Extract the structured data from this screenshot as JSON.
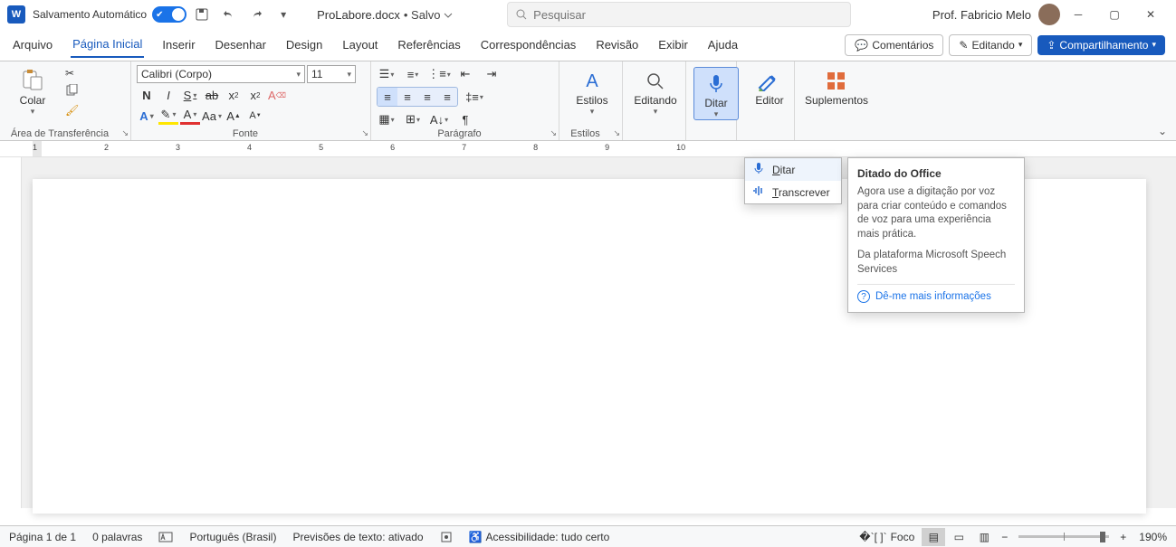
{
  "title_bar": {
    "autosave_label": "Salvamento Automático",
    "doc_name": "ProLabore.docx",
    "saved_state": "• Salvo",
    "search_placeholder": "Pesquisar",
    "user_name": "Prof. Fabricio Melo"
  },
  "menu": {
    "items": [
      "Arquivo",
      "Página Inicial",
      "Inserir",
      "Desenhar",
      "Design",
      "Layout",
      "Referências",
      "Correspondências",
      "Revisão",
      "Exibir",
      "Ajuda"
    ],
    "active": "Página Inicial",
    "comments": "Comentários",
    "editing": "Editando",
    "share": "Compartilhamento"
  },
  "ribbon": {
    "clipboard": {
      "paste": "Colar",
      "group": "Área de Transferência"
    },
    "font": {
      "family": "Calibri (Corpo)",
      "size": "11",
      "group": "Fonte"
    },
    "paragraph": {
      "group": "Parágrafo"
    },
    "styles": {
      "label": "Estilos",
      "group": "Estilos"
    },
    "editing_big": "Editando",
    "dictate": "Ditar",
    "editor": "Editor",
    "addins": "Suplementos"
  },
  "popup": {
    "ditar": "Ditar",
    "trans": "Transcrever"
  },
  "callout": {
    "title": "Ditado do Office",
    "body1": "Agora use a digitação por voz para criar conteúdo e comandos de voz para uma experiência mais prática.",
    "body2": "Da plataforma Microsoft Speech Services",
    "link": "Dê-me mais informações"
  },
  "status": {
    "page": "Página 1 de 1",
    "words": "0 palavras",
    "lang": "Português (Brasil)",
    "pred": "Previsões de texto: ativado",
    "acc": "Acessibilidade: tudo certo",
    "focus": "Foco",
    "zoom": "190%"
  },
  "ruler_nums": [
    "1",
    "2",
    "3",
    "4",
    "5",
    "6",
    "7",
    "8",
    "9",
    "10"
  ]
}
